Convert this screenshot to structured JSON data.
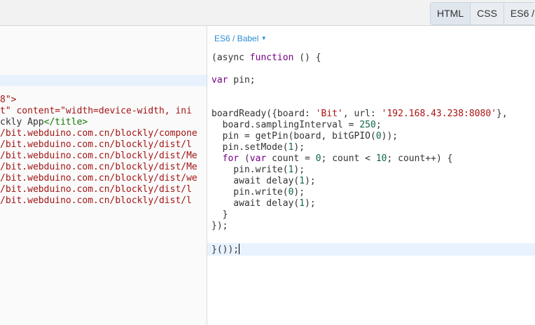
{
  "tabs": [
    {
      "label": "HTML",
      "active": true
    },
    {
      "label": "CSS",
      "active": false
    },
    {
      "label": "ES6 /",
      "active": false
    }
  ],
  "left_editor": {
    "lines": [
      {
        "red": "8\">",
        "dark": ""
      },
      {
        "red": "t\" content=\"width=device-width, ini",
        "dark": ""
      },
      {
        "red": "",
        "dark": "ckly App",
        "red2": "</title>"
      },
      {
        "red": "/bit.webduino.com.cn/blockly/compone",
        "dark": ""
      },
      {
        "red": "/bit.webduino.com.cn/blockly/dist/l",
        "dark": ""
      },
      {
        "red": "/bit.webduino.com.cn/blockly/dist/Me",
        "dark": ""
      },
      {
        "red": "/bit.webduino.com.cn/blockly/dist/Me",
        "dark": ""
      },
      {
        "red": "/bit.webduino.com.cn/blockly/dist/we",
        "dark": ""
      },
      {
        "red": "/bit.webduino.com.cn/blockly/dist/l",
        "dark": ""
      },
      {
        "red": "/bit.webduino.com.cn/blockly/dist/l",
        "dark": ""
      }
    ]
  },
  "right_editor": {
    "language_label": "ES6 / Babel",
    "code": {
      "l1_open": "(async ",
      "l1_kw": "function",
      "l1_rest": " () {",
      "l2_kw": "var",
      "l2_rest": " pin;",
      "l3_a": "boardReady({board: ",
      "l3_s1": "'Bit'",
      "l3_b": ", url: ",
      "l3_s2": "'192.168.43.238:8080'",
      "l3_c": "},",
      "l4_a": "  board.samplingInterval = ",
      "l4_n": "250",
      "l4_b": ";",
      "l5_a": "  pin = getPin(board, bitGPIO(",
      "l5_n": "0",
      "l5_b": "));",
      "l6_a": "  pin.setMode(",
      "l6_n": "1",
      "l6_b": ");",
      "l7_kw1": "  for",
      "l7_a": " (",
      "l7_kw2": "var",
      "l7_b": " count = ",
      "l7_n1": "0",
      "l7_c": "; count < ",
      "l7_n2": "10",
      "l7_d": "; count++) {",
      "l8_a": "    pin.write(",
      "l8_n": "1",
      "l8_b": ");",
      "l9_a": "    await delay(",
      "l9_n": "1",
      "l9_b": ");",
      "l10_a": "    pin.write(",
      "l10_n": "0",
      "l10_b": ");",
      "l11_a": "    await delay(",
      "l11_n": "1",
      "l11_b": ");",
      "l12": "  }",
      "l13": "});",
      "l14": "}());"
    }
  }
}
